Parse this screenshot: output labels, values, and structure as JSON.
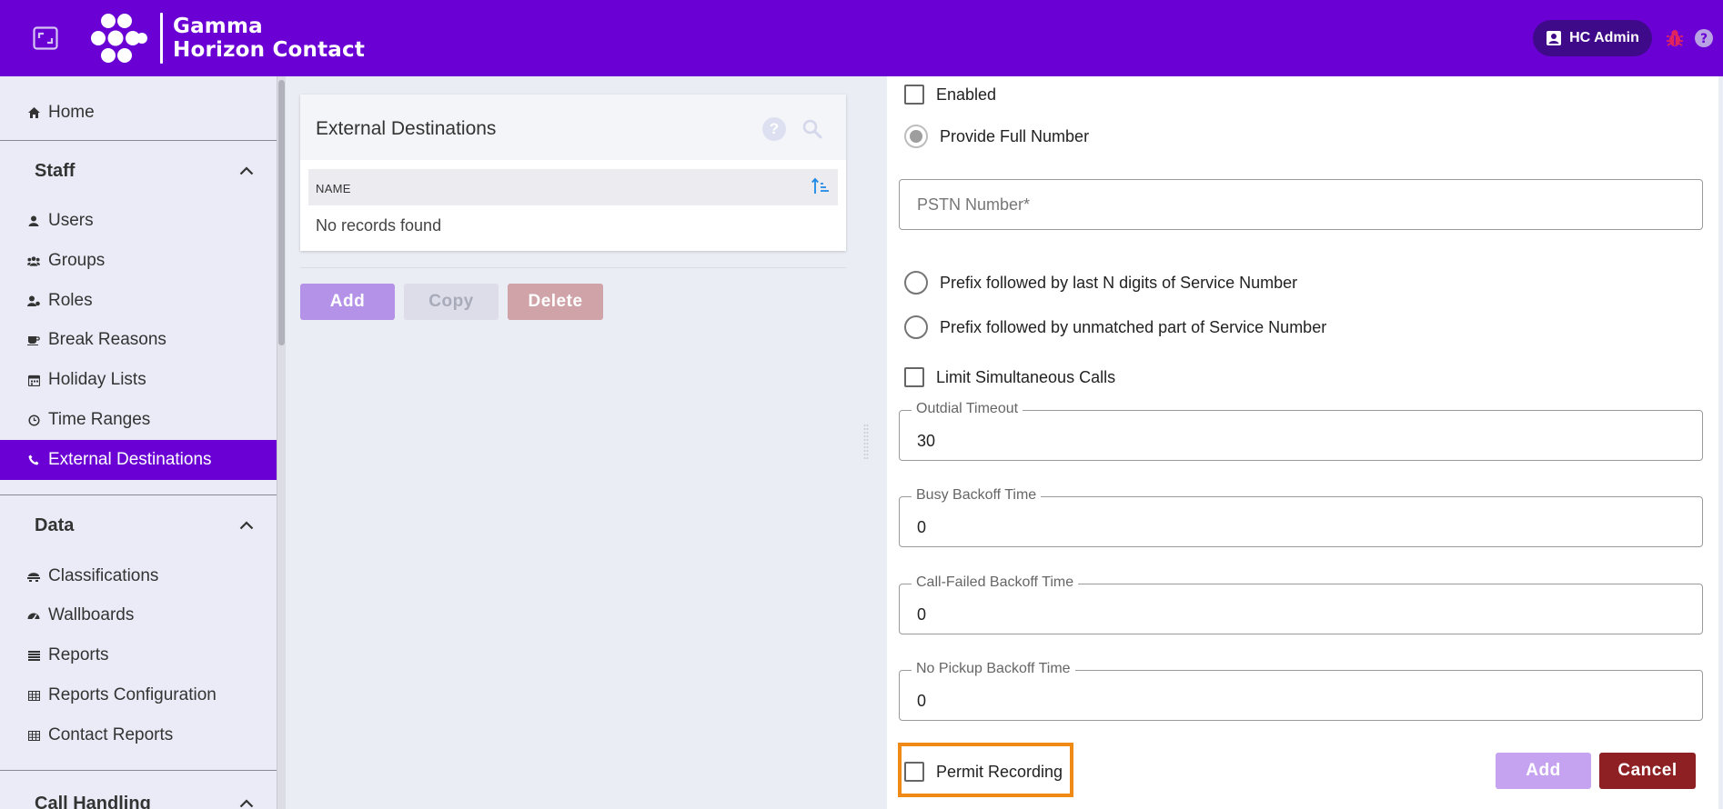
{
  "header": {
    "brand_line1": "Gamma",
    "brand_line2": "Horizon Contact",
    "user_label": "HC Admin",
    "icons": [
      "expand-icon",
      "gamma-logo",
      "user-badge-icon",
      "bug-icon",
      "help-icon"
    ],
    "colors": {
      "bar": "#6a00d4",
      "pill": "#3f0a8a",
      "bug": "#e0245e"
    }
  },
  "sidebar": {
    "home_label": "Home",
    "staff_label": "Staff",
    "staff_items": [
      {
        "label": "Users",
        "icon": "user-icon"
      },
      {
        "label": "Groups",
        "icon": "groups-icon"
      },
      {
        "label": "Roles",
        "icon": "roles-icon"
      },
      {
        "label": "Break Reasons",
        "icon": "coffee-icon"
      },
      {
        "label": "Holiday Lists",
        "icon": "calendar-icon"
      },
      {
        "label": "Time Ranges",
        "icon": "clock-icon"
      },
      {
        "label": "External Destinations",
        "icon": "phone-icon",
        "active": true
      }
    ],
    "data_label": "Data",
    "data_items": [
      {
        "label": "Classifications",
        "icon": "classification-icon"
      },
      {
        "label": "Wallboards",
        "icon": "dashboard-icon"
      },
      {
        "label": "Reports",
        "icon": "reports-icon"
      },
      {
        "label": "Reports Configuration",
        "icon": "table-icon"
      },
      {
        "label": "Contact Reports",
        "icon": "table-icon"
      }
    ],
    "call_handling_label": "Call Handling",
    "active_color": "#6a00d4"
  },
  "list_panel": {
    "title": "External Destinations",
    "column_name": "NAME",
    "empty_text": "No records found",
    "buttons": {
      "add": "Add",
      "copy": "Copy",
      "delete": "Delete"
    }
  },
  "form": {
    "enabled_label": "Enabled",
    "provide_full_number_label": "Provide Full Number",
    "pstn_placeholder": "PSTN Number*",
    "prefix_last_n_label": "Prefix followed by last N digits of Service Number",
    "prefix_unmatched_label": "Prefix followed by unmatched part of Service Number",
    "limit_calls_label": "Limit Simultaneous Calls",
    "outdial_timeout": {
      "label": "Outdial Timeout",
      "value": "30"
    },
    "busy_backoff": {
      "label": "Busy Backoff Time",
      "value": "0"
    },
    "call_failed_backoff": {
      "label": "Call-Failed Backoff Time",
      "value": "0"
    },
    "no_pickup_backoff": {
      "label": "No Pickup Backoff Time",
      "value": "0"
    },
    "permit_recording_label": "Permit Recording",
    "add_button": "Add",
    "cancel_button": "Cancel",
    "highlight_color": "#ef8a17"
  }
}
